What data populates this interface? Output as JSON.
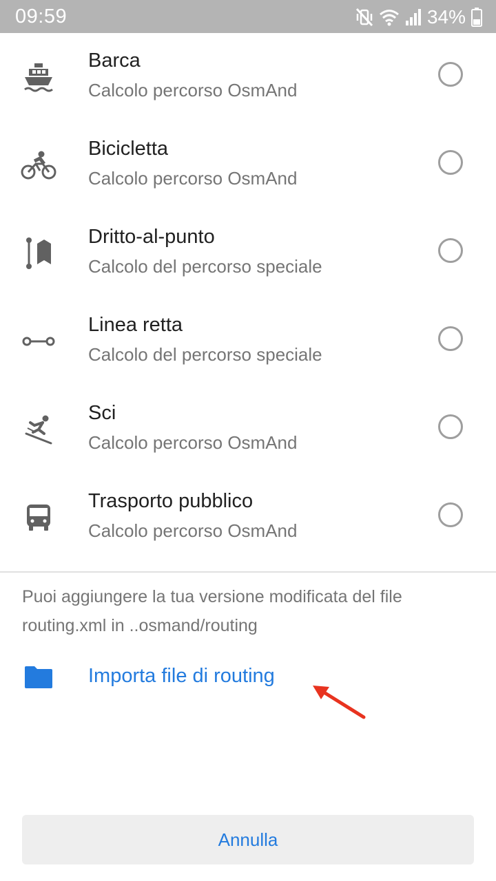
{
  "status_bar": {
    "time": "09:59",
    "battery_percent": "34%",
    "icons": [
      "vibrate-mute-icon",
      "wifi-icon",
      "signal-icon",
      "battery-icon"
    ]
  },
  "routing_options": [
    {
      "title": "Barca",
      "subtitle": "Calcolo percorso OsmAnd",
      "icon": "boat-icon",
      "selected": false
    },
    {
      "title": "Bicicletta",
      "subtitle": "Calcolo percorso OsmAnd",
      "icon": "bicycle-icon",
      "selected": false
    },
    {
      "title": "Dritto-al-punto",
      "subtitle": "Calcolo del percorso speciale",
      "icon": "direct-to-point-icon",
      "selected": false
    },
    {
      "title": "Linea retta",
      "subtitle": "Calcolo del percorso speciale",
      "icon": "straight-line-icon",
      "selected": false
    },
    {
      "title": "Sci",
      "subtitle": "Calcolo percorso OsmAnd",
      "icon": "ski-icon",
      "selected": false
    },
    {
      "title": "Trasporto pubblico",
      "subtitle": "Calcolo percorso OsmAnd",
      "icon": "bus-icon",
      "selected": false
    }
  ],
  "info_text": "Puoi aggiungere la tua versione modificata del file routing.xml in ..osmand/routing",
  "import": {
    "label": "Importa file di routing",
    "icon": "folder-icon"
  },
  "cancel_label": "Annulla",
  "colors": {
    "accent": "#237bde",
    "status_bar": "#b4b4b4",
    "annotation_arrow": "#e8331f"
  }
}
